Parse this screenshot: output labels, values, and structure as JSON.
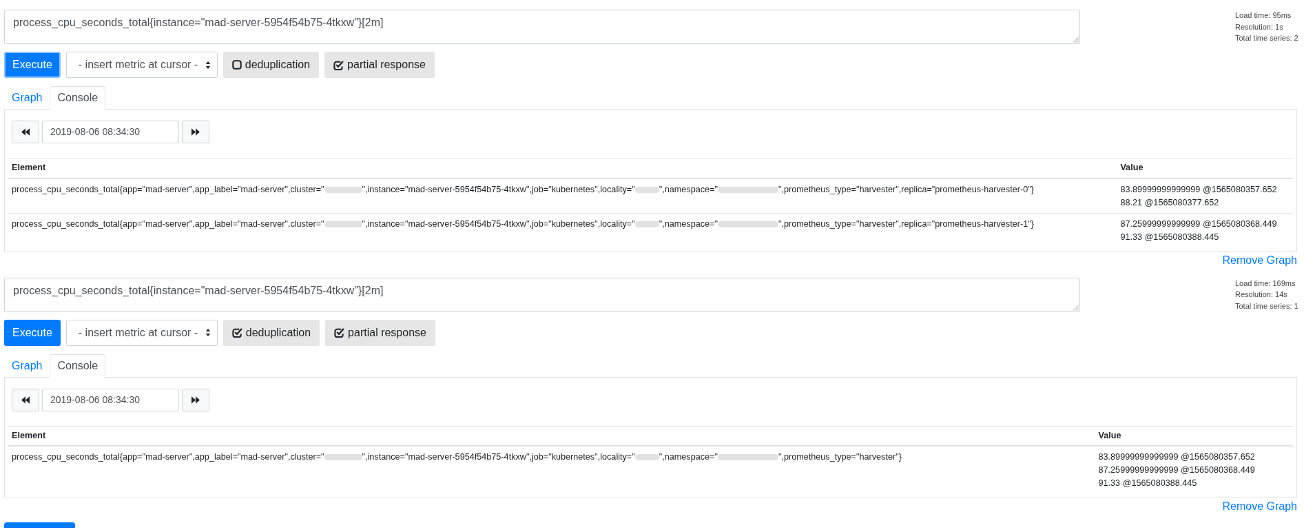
{
  "panels": [
    {
      "query": "process_cpu_seconds_total{instance=\"mad-server-5954f54b75-4tkxw\"}[2m]",
      "stats": [
        "Load time: 95ms",
        "Resolution: 1s",
        "Total time series: 2"
      ],
      "execute": {
        "label": "Execute",
        "focused": true
      },
      "metric_select": {
        "value": "- insert metric at cursor -"
      },
      "toggles": [
        {
          "label": "deduplication",
          "checked": false
        },
        {
          "label": "partial response",
          "checked": true
        }
      ],
      "tabs": [
        {
          "label": "Graph",
          "selected": false
        },
        {
          "label": "Console",
          "selected": true
        }
      ],
      "time": {
        "value": "2019-08-06 08:34:30"
      },
      "table": {
        "columns": [
          "Element",
          "Value"
        ],
        "rows": [
          {
            "element": [
              {
                "kind": "text",
                "text": "process_cpu_seconds_total{app=\"mad-server\",app_label=\"mad-server\",cluster=\""
              },
              {
                "kind": "blurred"
              },
              {
                "kind": "text",
                "text": "\",instance=\"mad-server-5954f54b75-4tkxw\",job=\"kubernetes\",locality=\""
              },
              {
                "kind": "blurred"
              },
              {
                "kind": "text",
                "text": "\",namespace=\""
              },
              {
                "kind": "blurred"
              },
              {
                "kind": "text",
                "text": "\",prometheus_type=\"harvester\",replica=\"prometheus-harvester-0\"}"
              }
            ],
            "values": [
              "83.89999999999999 @1565080357.652",
              "88.21 @1565080377.652"
            ]
          },
          {
            "element": [
              {
                "kind": "text",
                "text": "process_cpu_seconds_total{app=\"mad-server\",app_label=\"mad-server\",cluster=\""
              },
              {
                "kind": "blurred"
              },
              {
                "kind": "text",
                "text": "\",instance=\"mad-server-5954f54b75-4tkxw\",job=\"kubernetes\",locality=\""
              },
              {
                "kind": "blurred"
              },
              {
                "kind": "text",
                "text": "\",namespace=\""
              },
              {
                "kind": "blurred"
              },
              {
                "kind": "text",
                "text": "\",prometheus_type=\"harvester\",replica=\"prometheus-harvester-1\"}"
              }
            ],
            "values": [
              "87.25999999999999 @1565080368.449",
              "91.33 @1565080388.445"
            ]
          }
        ]
      },
      "remove_link": "Remove Graph"
    },
    {
      "query": "process_cpu_seconds_total{instance=\"mad-server-5954f54b75-4tkxw\"}[2m]",
      "stats": [
        "Load time: 169ms",
        "Resolution: 14s",
        "Total time series: 1"
      ],
      "execute": {
        "label": "Execute",
        "focused": false
      },
      "metric_select": {
        "value": "- insert metric at cursor -"
      },
      "toggles": [
        {
          "label": "deduplication",
          "checked": true
        },
        {
          "label": "partial response",
          "checked": true
        }
      ],
      "tabs": [
        {
          "label": "Graph",
          "selected": false
        },
        {
          "label": "Console",
          "selected": true
        }
      ],
      "time": {
        "value": "2019-08-06 08:34:30"
      },
      "table": {
        "columns": [
          "Element",
          "Value"
        ],
        "rows": [
          {
            "element": [
              {
                "kind": "text",
                "text": "process_cpu_seconds_total{app=\"mad-server\",app_label=\"mad-server\",cluster=\""
              },
              {
                "kind": "blurred"
              },
              {
                "kind": "text",
                "text": "\",instance=\"mad-server-5954f54b75-4tkxw\",job=\"kubernetes\",locality=\""
              },
              {
                "kind": "blurred"
              },
              {
                "kind": "text",
                "text": "\",namespace=\""
              },
              {
                "kind": "blurred"
              },
              {
                "kind": "text",
                "text": "\",prometheus_type=\"harvester\"}"
              }
            ],
            "values": [
              "83.89999999999999 @1565080357.652",
              "87.25999999999999 @1565080368.449",
              "91.33 @1565080388.445"
            ]
          }
        ]
      },
      "remove_link": "Remove Graph"
    }
  ]
}
